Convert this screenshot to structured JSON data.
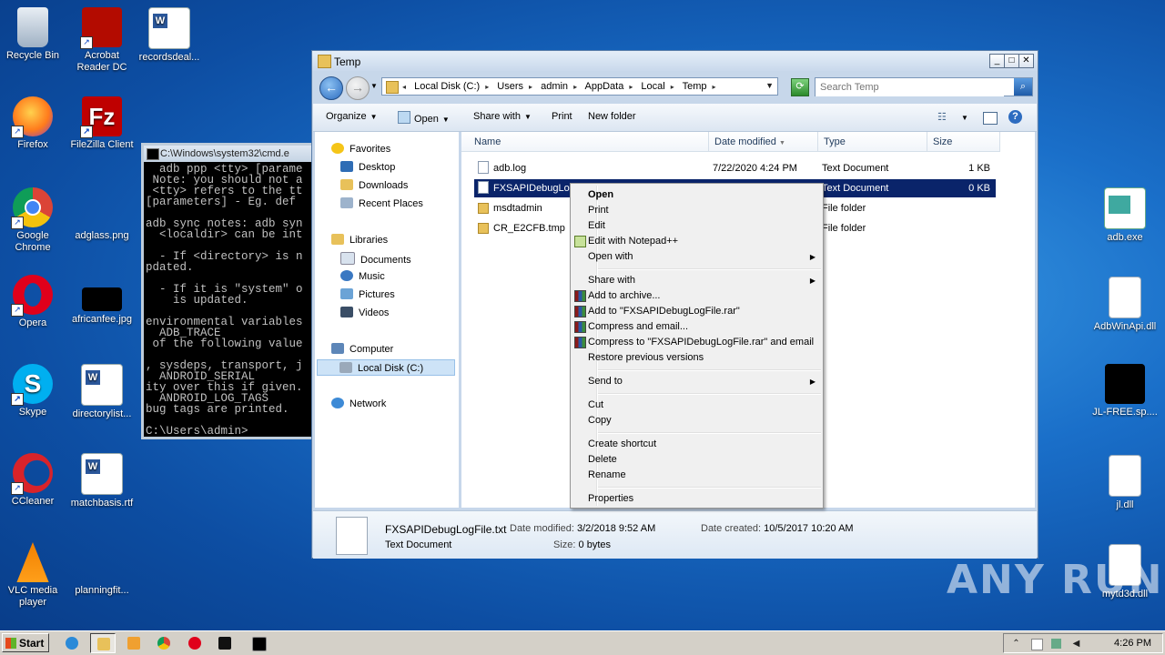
{
  "desktop": {
    "left_icons": [
      {
        "label": "Recycle Bin"
      },
      {
        "label": "Acrobat Reader DC"
      },
      {
        "label": "recordsdeal..."
      },
      {
        "label": "Firefox"
      },
      {
        "label": "FileZilla Client"
      },
      {
        "label": "Google Chrome"
      },
      {
        "label": "adglass.png"
      },
      {
        "label": "Opera"
      },
      {
        "label": "africanfee.jpg"
      },
      {
        "label": "Skype"
      },
      {
        "label": "directorylist..."
      },
      {
        "label": "CCleaner"
      },
      {
        "label": "matchbasis.rtf"
      },
      {
        "label": "VLC media player"
      },
      {
        "label": "planningfit..."
      }
    ],
    "right_icons": [
      {
        "label": "adb.exe"
      },
      {
        "label": "AdbWinApi.dll"
      },
      {
        "label": "JL-FREE.sp...."
      },
      {
        "label": "jl.dll"
      },
      {
        "label": "mytd3d.dll"
      }
    ],
    "watermark": "ANY RUN"
  },
  "cmd": {
    "title": "C:\\Windows\\system32\\cmd.e",
    "lines": "  adb ppp <tty> [parame\n Note: you should not a\n <tty> refers to the tt\n[parameters] - Eg. def\n\nadb sync notes: adb syn\n  <localdir> can be int\n\n  - If <directory> is n\npdated.\n\n  - If it is \"system\" o\n    is updated.\n\nenvironmental variables\n  ADB_TRACE\n of the following value\n\n, sysdeps, transport, j\n  ANDROID_SERIAL\nity over this if given.\n  ANDROID_LOG_TAGS\nbug tags are printed.\n\nC:\\Users\\admin>"
  },
  "explorer": {
    "title": "Temp",
    "breadcrumbs": [
      "Local Disk (C:)",
      "Users",
      "admin",
      "AppData",
      "Local",
      "Temp"
    ],
    "search_placeholder": "Search Temp",
    "toolbar": {
      "organize": "Organize",
      "open": "Open",
      "share_with": "Share with",
      "print": "Print",
      "new_folder": "New folder"
    },
    "nav": {
      "favorites": "Favorites",
      "desktop": "Desktop",
      "downloads": "Downloads",
      "recent": "Recent Places",
      "libraries": "Libraries",
      "documents": "Documents",
      "music": "Music",
      "pictures": "Pictures",
      "videos": "Videos",
      "computer": "Computer",
      "local_disk": "Local Disk (C:)",
      "network": "Network"
    },
    "columns": {
      "name": "Name",
      "date": "Date modified",
      "type": "Type",
      "size": "Size"
    },
    "files": [
      {
        "name": "adb.log",
        "date": "7/22/2020 4:24 PM",
        "type": "Text Document",
        "size": "1 KB",
        "icon": "doc"
      },
      {
        "name": "FXSAPIDebugLog",
        "date": "",
        "type": "Text Document",
        "size": "0 KB",
        "icon": "doc"
      },
      {
        "name": "msdtadmin",
        "date": "",
        "type": "File folder",
        "size": "",
        "icon": "folder"
      },
      {
        "name": "CR_E2CFB.tmp",
        "date": "",
        "type": "File folder",
        "size": "",
        "icon": "folder"
      }
    ],
    "details": {
      "filename": "FXSAPIDebugLogFile.txt",
      "modified_label": "Date modified:",
      "modified": "3/2/2018 9:52 AM",
      "created_label": "Date created:",
      "created": "10/5/2017 10:20 AM",
      "type": "Text Document",
      "size_label": "Size:",
      "size": "0 bytes"
    }
  },
  "context_menu": {
    "open": "Open",
    "print": "Print",
    "edit": "Edit",
    "edit_npp": "Edit with Notepad++",
    "open_with": "Open with",
    "share_with": "Share with",
    "add_archive": "Add to archive...",
    "add_rar": "Add to \"FXSAPIDebugLogFile.rar\"",
    "compress_email": "Compress and email...",
    "compress_rar_email": "Compress to \"FXSAPIDebugLogFile.rar\" and email",
    "restore": "Restore previous versions",
    "send_to": "Send to",
    "cut": "Cut",
    "copy": "Copy",
    "create_shortcut": "Create shortcut",
    "delete": "Delete",
    "rename": "Rename",
    "properties": "Properties"
  },
  "taskbar": {
    "start": "Start",
    "clock": "4:26 PM"
  }
}
